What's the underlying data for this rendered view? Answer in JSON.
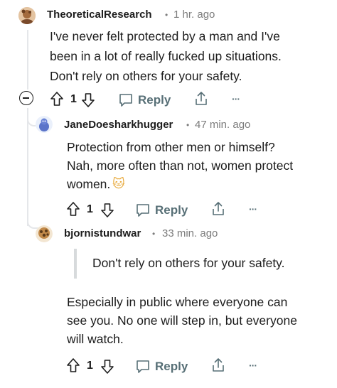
{
  "comments": [
    {
      "username": "TheoreticalResearch",
      "time": "1 hr. ago",
      "body_lines": [
        "I've never felt protected by a man and I've",
        "been in a lot of really fucked up situations.",
        "Don't rely on others for your safety."
      ],
      "votes": "1",
      "reply_label": "Reply",
      "collapse_symbol": "−",
      "more_symbol": "···"
    },
    {
      "username": "JaneDoesharkhugger",
      "time": "47 min. ago",
      "body_lines": [
        "Protection from other men or himself?",
        "Nah, more often than not, women protect",
        "women."
      ],
      "emoji": "🐱",
      "votes": "1",
      "reply_label": "Reply",
      "more_symbol": "···"
    },
    {
      "username": "bjornistundwar",
      "time": "33 min. ago",
      "quote": "Don't rely on others for your safety.",
      "body_lines": [
        "Especially in public where everyone can",
        "see you. No one will step in, but everyone",
        "will watch."
      ],
      "votes": "1",
      "reply_label": "Reply",
      "more_symbol": "···"
    }
  ],
  "separator": "•",
  "colors": {
    "text": "#1c1c1c",
    "meta": "#7c7c7c",
    "action": "#576f76",
    "thread": "#e5e7ea"
  }
}
